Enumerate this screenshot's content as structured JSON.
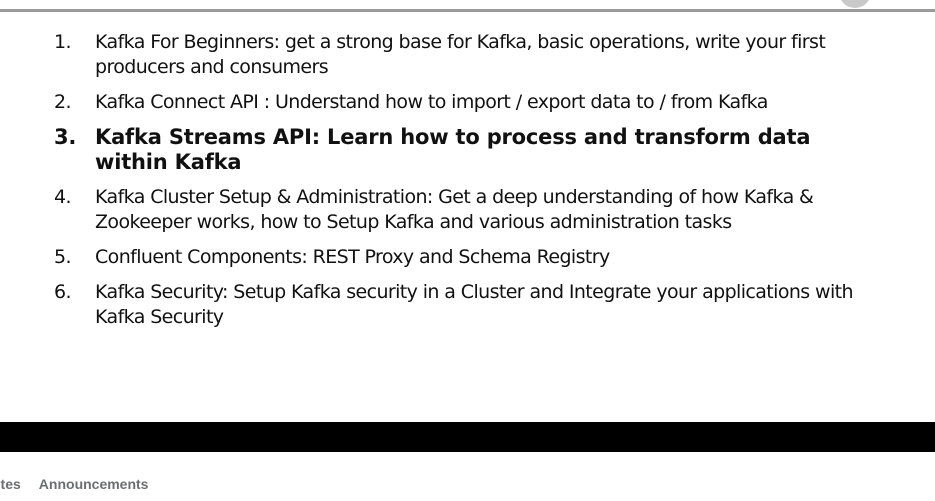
{
  "slide": {
    "items": [
      {
        "number": "1.",
        "text": "Kafka For Beginners: get a strong base for Kafka, basic operations, write your first producers and consumers",
        "bold": false
      },
      {
        "number": "2.",
        "text": "Kafka Connect API : Understand how to import / export data to / from Kafka",
        "bold": false
      },
      {
        "number": "3.",
        "text": "Kafka Streams API: Learn how to process and transform data within Kafka",
        "bold": true
      },
      {
        "number": "4.",
        "text": "Kafka Cluster Setup & Administration: Get a deep understanding of how Kafka & Zookeeper works, how to Setup Kafka and various administration tasks",
        "bold": false
      },
      {
        "number": "5.",
        "text": "Confluent Components: REST Proxy and Schema Registry",
        "bold": false
      },
      {
        "number": "6.",
        "text": "Kafka Security: Setup Kafka security in a Cluster and Integrate your applications with Kafka Security",
        "bold": false
      }
    ]
  },
  "tabs": {
    "notes_label": "otes",
    "announcements_label": "Announcements"
  },
  "colors": {
    "top_rule": "#9a9a9a",
    "bar": "#000000",
    "tab_text": "#6a6f73"
  }
}
